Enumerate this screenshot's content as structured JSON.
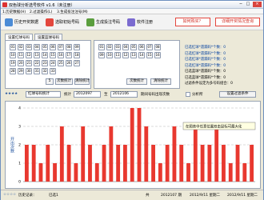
{
  "window": {
    "title": "双色球分析选号软件 v1.6（未注册）",
    "min_glyph": "─",
    "max_glyph": "□",
    "close_glyph": "×"
  },
  "menu": [
    "1.历史数据(H)",
    "2.过滤操作(L)",
    "3.生成投注注号(M)"
  ],
  "toolbar": {
    "history": "历史开奖数据",
    "pick_initial": "选取初始号码",
    "generate_bets": "生成投注号码",
    "help": "软件注册",
    "how_to_buy": "如何购买？",
    "detail_help": "详细开奖情况查询"
  },
  "tabs": [
    "设置红球号码",
    "设置蓝球号码"
  ],
  "red_numbers": [
    "01",
    "02",
    "03",
    "04",
    "05",
    "06",
    "07",
    "08",
    "09",
    "10",
    "11",
    "12",
    "13",
    "14",
    "15",
    "16",
    "17",
    "18",
    "19",
    "20",
    "21",
    "22",
    "23",
    "24",
    "25",
    "26",
    "27",
    "28",
    "29",
    "30",
    "31",
    "32",
    "33"
  ],
  "blue_numbers": [
    "01",
    "02",
    "03",
    "04",
    "05",
    "06",
    "07",
    "08",
    "09",
    "10",
    "11",
    "12",
    "13",
    "14",
    "15",
    "16"
  ],
  "red_panel": {
    "sub_count": "5",
    "stats_button": "次数统计",
    "clear_button": "清除统计"
  },
  "blue_panel": {
    "stats_button": "次数统计",
    "clear_button": "清除统计"
  },
  "stats": [
    {
      "text": "已选红球*遗漏码*个数：0",
      "blue": true
    },
    {
      "text": "已选红球*遗漏码*个数：0",
      "blue": true
    },
    {
      "text": "已选红球*遗漏码*个数：0",
      "blue": true
    },
    {
      "text": "已选红球*遗漏码*个数：0",
      "blue": true
    },
    {
      "text": "已选蓝球*遗漏码*个数：0",
      "blue": false
    },
    {
      "text": "已选蓝球*遗漏码*个数：0",
      "blue": false
    },
    {
      "text": "过滤条件设定为多号码组合：0",
      "blue": false
    }
  ],
  "chart_controls": {
    "stars": "★★★★",
    "filter_select": "红球号码统计",
    "range_label": "统计",
    "from_select": "2012097",
    "to_label": "至",
    "to_select": "2012106",
    "mode_label": "期间号码出现次数",
    "checkbox_label": "分析所",
    "settings_button": "设置过滤条件"
  },
  "chart_data": {
    "type": "bar",
    "title": "",
    "xlabel": "",
    "ylabel": "开出次数",
    "ylim": [
      0,
      4
    ],
    "yticks": [
      0,
      1,
      2,
      3,
      4
    ],
    "categories": [
      "01",
      "02",
      "03",
      "04",
      "05",
      "06",
      "07",
      "08",
      "09",
      "10",
      "11",
      "12",
      "13",
      "14",
      "15",
      "16",
      "17",
      "18",
      "19",
      "20",
      "21",
      "22",
      "23",
      "24",
      "25",
      "26",
      "27",
      "28",
      "29",
      "30",
      "31",
      "32",
      "33"
    ],
    "values": [
      2,
      2,
      1,
      2,
      1,
      3,
      2,
      1,
      3,
      2,
      1,
      2,
      3,
      2,
      2,
      4,
      4,
      3,
      2,
      1,
      2,
      3,
      2,
      1,
      3,
      2,
      2,
      3,
      2,
      1,
      2,
      1,
      2
    ],
    "tooltip": "在图表中任意位置双击鼠标可最大化"
  },
  "status": {
    "stars": "☆☆☆☆",
    "label": "历史记录：",
    "count": "已选1",
    "sep": "共",
    "record": "2012107 期",
    "date1": "2012/9/11 星期二",
    "date2": "2012/9/11 星期二"
  },
  "colors": {
    "bar": "#e8382f",
    "title_text": "#1b4f9c",
    "accent_red": "#d12a20"
  }
}
